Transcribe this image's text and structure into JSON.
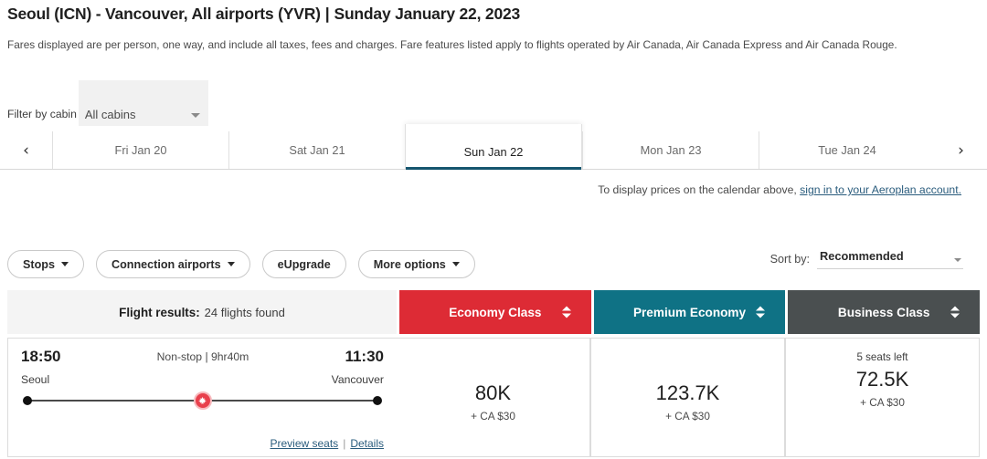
{
  "header": {
    "route": "Seoul (ICN) - Vancouver, All airports (YVR)",
    "separator": "|",
    "date": "Sunday January 22, 2023",
    "disclaimer": "Fares displayed are per person, one way, and include all taxes, fees and charges. Fare features listed apply to flights operated by Air Canada, Air Canada Express and Air Canada Rouge."
  },
  "cabin_filter": {
    "label": "Filter by cabin",
    "value": "All cabins",
    "caret_icon": "chevron-down-icon"
  },
  "date_tabs": {
    "prev_icon": "chevron-left-icon",
    "next_icon": "chevron-right-icon",
    "items": [
      {
        "label": "Fri Jan 20",
        "active": false
      },
      {
        "label": "Sat Jan 21",
        "active": false
      },
      {
        "label": "Sun Jan 22",
        "active": true
      },
      {
        "label": "Mon Jan 23",
        "active": false
      },
      {
        "label": "Tue Jan 24",
        "active": false
      }
    ]
  },
  "signin_note": {
    "text": "To display prices on the calendar above, ",
    "link": "sign in to your Aeroplan account."
  },
  "filters": [
    {
      "label": "Stops",
      "has_caret": true
    },
    {
      "label": "Connection airports",
      "has_caret": true
    },
    {
      "label": "eUpgrade",
      "has_caret": false
    },
    {
      "label": "More options",
      "has_caret": true
    }
  ],
  "sort": {
    "label": "Sort by:",
    "value": "Recommended",
    "caret_icon": "chevron-down-icon"
  },
  "results_header": {
    "results_label": "Flight results:",
    "results_count": "24 flights found",
    "columns": [
      {
        "label": "Economy Class",
        "color": "#dd2b35"
      },
      {
        "label": "Premium Economy",
        "color": "#0f7285"
      },
      {
        "label": "Business Class",
        "color": "#4a4f50"
      }
    ]
  },
  "flight": {
    "depart_time": "18:50",
    "arrive_time": "11:30",
    "duration": "Non-stop | 9hr40m",
    "origin": "Seoul",
    "destination": "Vancouver",
    "carrier_icon": "maple-leaf-icon",
    "preview_seats": "Preview seats",
    "links_sep": "|",
    "details": "Details",
    "fares": [
      {
        "seats": "",
        "price": "80K",
        "tax": "+ CA $30"
      },
      {
        "seats": "",
        "price": "123.7K",
        "tax": "+ CA $30"
      },
      {
        "seats": "5 seats left",
        "price": "72.5K",
        "tax": "+ CA $30"
      }
    ]
  }
}
